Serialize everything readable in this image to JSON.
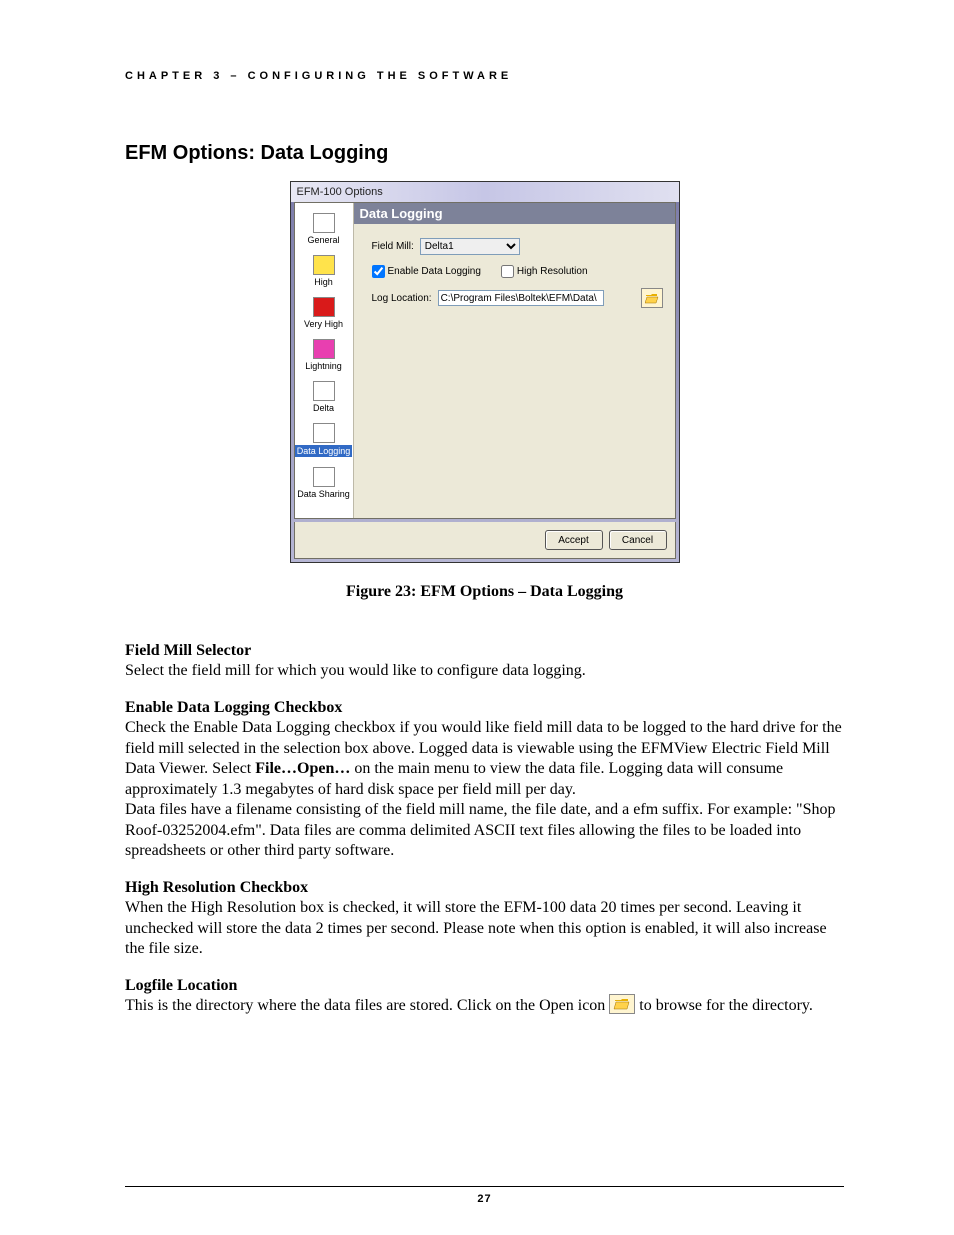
{
  "chapter_header": "CHAPTER 3 – CONFIGURING THE SOFTWARE",
  "section_title": "EFM Options: Data Logging",
  "dialog": {
    "title": "EFM-100 Options",
    "sidebar": [
      {
        "label": "General"
      },
      {
        "label": "High"
      },
      {
        "label": "Very High"
      },
      {
        "label": "Lightning"
      },
      {
        "label": "Delta"
      },
      {
        "label": "Data Logging"
      },
      {
        "label": "Data Sharing"
      }
    ],
    "panel_title": "Data Logging",
    "field_mill_label": "Field Mill:",
    "field_mill_value": "Delta1",
    "enable_label": "Enable Data Logging",
    "highres_label": "High Resolution",
    "log_location_label": "Log Location:",
    "log_location_value": "C:\\Program Files\\Boltek\\EFM\\Data\\",
    "accept_label": "Accept",
    "cancel_label": "Cancel"
  },
  "figure_caption": "Figure 23:  EFM Options – Data Logging",
  "sections": {
    "s1_head": "Field Mill Selector",
    "s1_body": "Select the field mill for which you would like to configure data logging.",
    "s2_head": "Enable Data Logging Checkbox",
    "s2_body1": "Check the Enable Data Logging checkbox if you would like field mill data to be logged to the hard drive for the field mill selected in the selection box above.  Logged data is viewable using the EFMView Electric Field Mill Data Viewer.  Select ",
    "s2_bold": "File…Open…",
    "s2_body2": " on the main menu to view the data file.  Logging data will consume approximately 1.3 megabytes of hard disk space per field mill per day.",
    "s2_body3": "Data files have a filename consisting of the field mill name, the file date, and a efm suffix.  For example: \"Shop Roof-03252004.efm\".  Data files are comma delimited ASCII text files allowing the files to be loaded into spreadsheets or other third party software.",
    "s3_head": "High Resolution Checkbox",
    "s3_body": "When the High Resolution box is checked, it will store the EFM-100 data 20 times per second. Leaving it unchecked will store the data 2 times per second. Please note when this option is enabled, it will also increase the file size.",
    "s4_head": "Logfile Location",
    "s4_body1": "This is the directory where the data files are stored.  Click on the Open icon ",
    "s4_body2": " to browse for the directory."
  },
  "page_number": "27"
}
